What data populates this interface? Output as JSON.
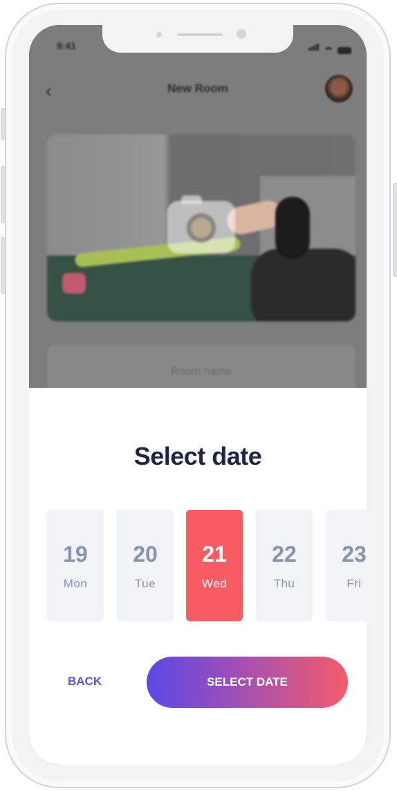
{
  "status_bar": {
    "time": "9:41"
  },
  "nav": {
    "title": "New Room"
  },
  "form": {
    "room_name_placeholder": "Room name"
  },
  "sheet": {
    "title": "Select date",
    "dates": [
      {
        "num": "19",
        "day": "Mon",
        "selected": false
      },
      {
        "num": "20",
        "day": "Tue",
        "selected": false
      },
      {
        "num": "21",
        "day": "Wed",
        "selected": true
      },
      {
        "num": "22",
        "day": "Thu",
        "selected": false
      },
      {
        "num": "23",
        "day": "Fri",
        "selected": false
      }
    ],
    "back_label": "BACK",
    "select_label": "SELECT DATE"
  },
  "colors": {
    "accent_selected": "#f95b62",
    "title_text": "#1e2444",
    "back_text": "#5f4ce0",
    "gradient_start": "#5a48e6",
    "gradient_end": "#f45c6a"
  }
}
